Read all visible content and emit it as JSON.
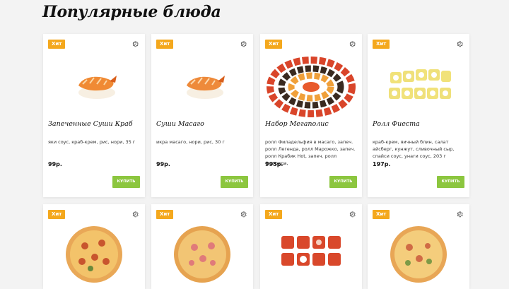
{
  "section": {
    "title": "Популярные блюда"
  },
  "colors": {
    "badge": "#f4a81d",
    "buy_button": "#8cc63f"
  },
  "products": [
    {
      "badge": "Хит",
      "image": "baked-crab-sushi",
      "name": "Запеченные Суши Краб",
      "desc": "яки соус, краб-крем, рис, нори, 35 г",
      "price": "99р.",
      "buy": "КУПИТЬ"
    },
    {
      "badge": "Хит",
      "image": "masago-sushi",
      "name": "Суши Масаго",
      "desc": "икра масаго, нори, рис, 30 г",
      "price": "99р.",
      "buy": "КУПИТЬ"
    },
    {
      "badge": "Хит",
      "image": "megapolis-set",
      "name": "Набор Мегаполис",
      "desc": "ролл Филадельфия в масаго, запеч. ролл Легенда, ролл Марожко, запеч. ролл Крабик Hot, запеч. ролл Флорида,",
      "price": "995р.",
      "buy": "КУПИТЬ"
    },
    {
      "badge": "Хит",
      "image": "fiesta-roll",
      "name": "Ролл Фиеста",
      "desc": "краб-крем, яичный блин, салат айсберг, кунжут, сливочный сыр, спайси соус, унаги соус, 203 г",
      "price": "197р.",
      "buy": "КУПИТЬ"
    },
    {
      "badge": "Хит",
      "image": "pizza"
    },
    {
      "badge": "Хит",
      "image": "pizza"
    },
    {
      "badge": "Хит",
      "image": "rolls-set"
    },
    {
      "badge": "Хит",
      "image": "pizza"
    }
  ]
}
